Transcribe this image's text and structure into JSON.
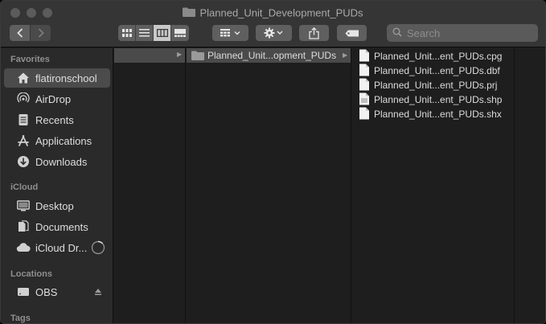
{
  "window": {
    "title": "Planned_Unit_Development_PUDs"
  },
  "toolbar": {
    "back_icon": "chevron-left-icon",
    "forward_icon": "chevron-right-icon",
    "view_modes": [
      "icon-view",
      "list-view",
      "column-view",
      "gallery-view"
    ],
    "active_view": "column-view",
    "group_icon": "group-grid-icon",
    "action_icon": "gear-icon",
    "share_icon": "share-icon",
    "tag_icon": "tag-icon",
    "search_placeholder": "Search"
  },
  "sidebar": {
    "favorites_header": "Favorites",
    "favorites": [
      {
        "label": "flatironschool",
        "icon": "home-icon"
      },
      {
        "label": "AirDrop",
        "icon": "airdrop-icon"
      },
      {
        "label": "Recents",
        "icon": "recents-icon"
      },
      {
        "label": "Applications",
        "icon": "applications-icon"
      },
      {
        "label": "Downloads",
        "icon": "downloads-icon"
      }
    ],
    "icloud_header": "iCloud",
    "icloud": [
      {
        "label": "Desktop",
        "icon": "desktop-icon"
      },
      {
        "label": "Documents",
        "icon": "documents-icon"
      },
      {
        "label": "iCloud Dr...",
        "icon": "icloud-drive-icon"
      }
    ],
    "locations_header": "Locations",
    "locations": [
      {
        "label": "OBS",
        "icon": "disk-icon"
      }
    ],
    "tags_header": "Tags"
  },
  "columns": {
    "folder_row": {
      "label": "Planned_Unit...opment_PUDs"
    },
    "files": [
      {
        "label": "Planned_Unit...ent_PUDs.cpg"
      },
      {
        "label": "Planned_Unit...ent_PUDs.dbf"
      },
      {
        "label": "Planned_Unit...ent_PUDs.prj"
      },
      {
        "label": "Planned_Unit...ent_PUDs.shp"
      },
      {
        "label": "Planned_Unit...ent_PUDs.shx"
      }
    ]
  }
}
